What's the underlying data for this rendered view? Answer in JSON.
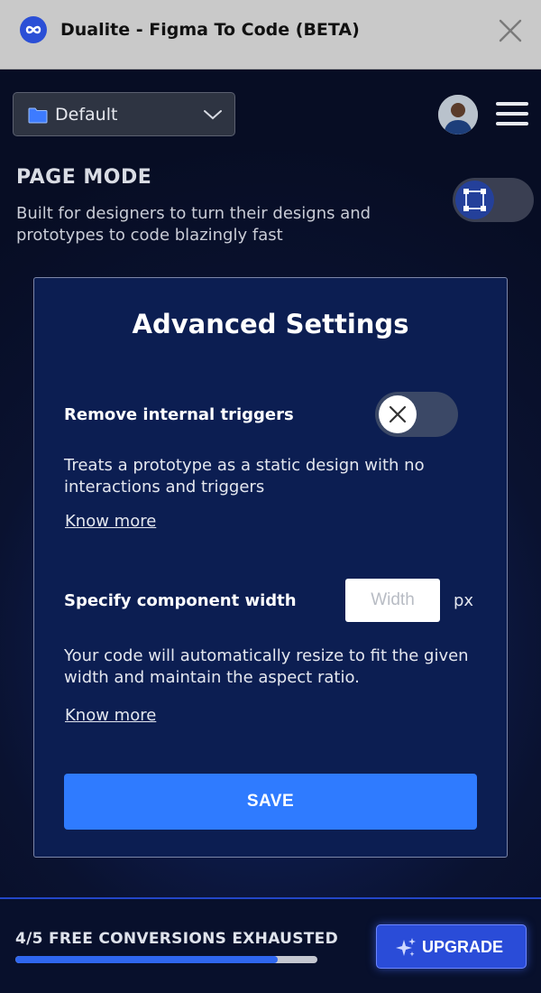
{
  "window": {
    "title": "Dualite - Figma To Code (BETA)",
    "logo_icon": "dualite-logo-icon",
    "close_icon": "close-icon"
  },
  "toolbar": {
    "project_select": {
      "value": "Default",
      "icon": "folder-icon"
    },
    "avatar_icon": "user-avatar",
    "menu_icon": "hamburger-menu-icon"
  },
  "page_mode": {
    "title": "PAGE MODE",
    "description": "Built for designers to turn their designs and prototypes to code blazingly fast",
    "toggle_icon": "frame-select-icon"
  },
  "advanced": {
    "title": "Advanced Settings",
    "remove_triggers": {
      "label": "Remove internal triggers",
      "description": "Treats a prototype as a static design with no interactions and triggers",
      "link": "Know more",
      "enabled": false
    },
    "component_width": {
      "label": "Specify component width",
      "placeholder": "Width",
      "unit": "px",
      "description": "Your code will automatically resize to fit the given width and maintain the aspect ratio.",
      "link": "Know more"
    },
    "save_label": "SAVE"
  },
  "footer": {
    "usage_text": "4/5 FREE CONVERSIONS EXHAUSTED",
    "usage_fraction": 0.87,
    "upgrade_label": "UPGRADE",
    "upgrade_icon": "sparkle-icon"
  },
  "colors": {
    "accent": "#2f7bff",
    "card_bg": "#0c1e52",
    "page_bg": "#0a1230",
    "upgrade": "#2a4cd8"
  }
}
